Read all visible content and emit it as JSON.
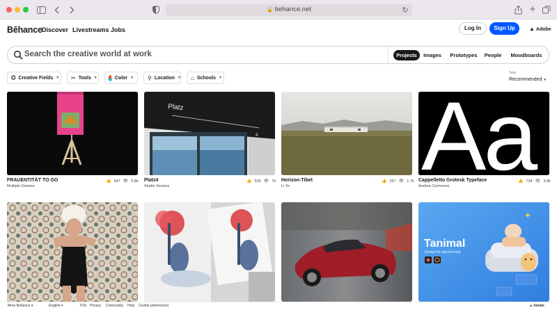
{
  "browser": {
    "url": "behance.net",
    "icons": [
      "sidebar-icon",
      "back-icon",
      "forward-icon",
      "privacy-shield-icon",
      "lock-icon",
      "reload-icon",
      "share-icon",
      "new-tab-icon",
      "tab-overview-icon"
    ]
  },
  "header": {
    "logo": "Bēhance",
    "nav": [
      "Discover",
      "Livestreams",
      "Jobs"
    ],
    "login": "Log In",
    "signup": "Sign Up",
    "adobe": "Adobe"
  },
  "search": {
    "placeholder": "Search the creative world at work",
    "tabs": [
      "Projects",
      "Images",
      "Prototypes",
      "People",
      "Moodboards"
    ],
    "active_tab": "Projects"
  },
  "filters": [
    "Creative Fields",
    "Tools",
    "Color",
    "Location",
    "Schools"
  ],
  "sort": {
    "label": "Sort",
    "value": "Recommended"
  },
  "projects": [
    {
      "title": "FRAUENTITÄT TO GO",
      "owner": "Multiple Owners",
      "likes": "647",
      "views": "5.8k"
    },
    {
      "title": "Platz4",
      "owner": "Studio Sexiess",
      "likes": "536",
      "views": "7k"
    },
    {
      "title": "Horizon-Tibet",
      "owner": "Li Ye",
      "likes": "267",
      "views": "1.7k"
    },
    {
      "title": "Cappelletto Grotesk Typeface",
      "owner": "Andrea Comunesi",
      "likes": "734",
      "views": "3.8k"
    },
    {
      "title": "",
      "owner": "",
      "likes": "",
      "views": ""
    },
    {
      "title": "",
      "owner": "",
      "likes": "",
      "views": ""
    },
    {
      "title": "",
      "owner": "",
      "likes": "",
      "views": ""
    },
    {
      "title": "",
      "owner": "",
      "likes": "",
      "views": ""
    }
  ],
  "artwork_text": {
    "platz_sign": "Platz",
    "platz_number": "4",
    "typeface_glyphs": "Aa",
    "tanimal_title": "Tanimal",
    "tanimal_subtitle": "Design for app develop"
  },
  "footer": {
    "more": "More Behance",
    "language": "English",
    "links": [
      "TOU",
      "Privacy",
      "Community",
      "Help",
      "Cookie preferences"
    ],
    "adobe": "Adobe"
  },
  "colors": {
    "accent": "#0057ff",
    "active_tab_bg": "#191919"
  }
}
